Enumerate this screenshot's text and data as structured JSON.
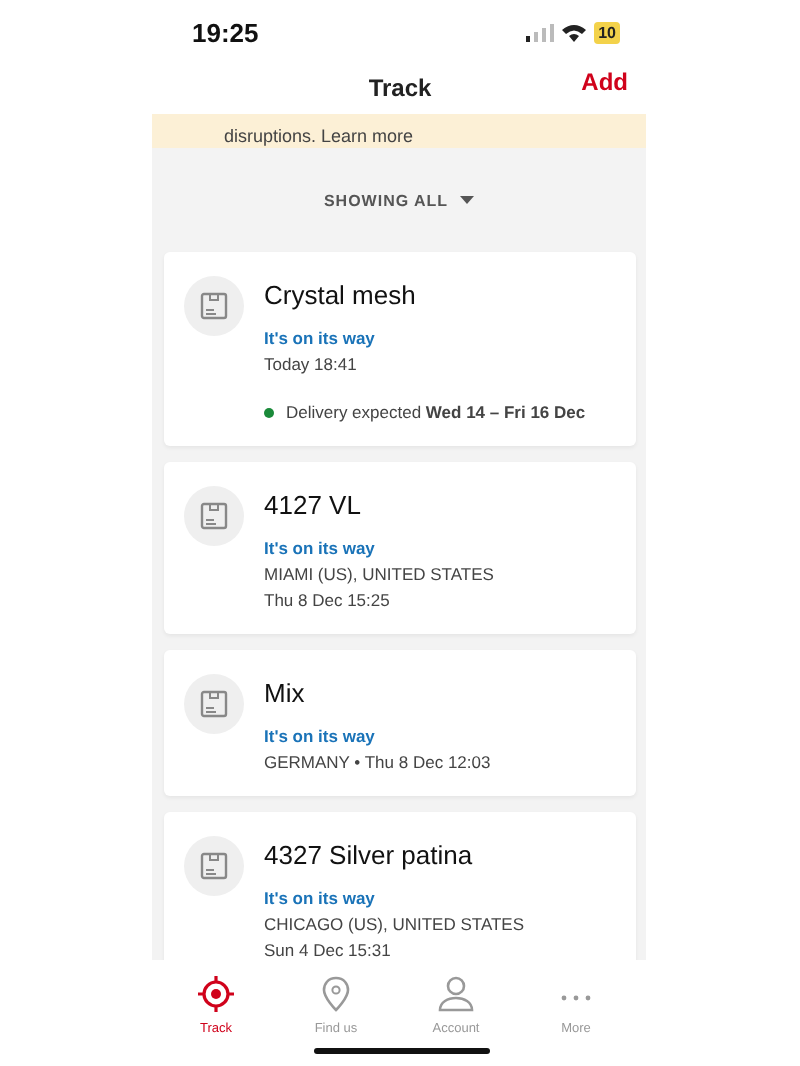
{
  "status_bar": {
    "time": "19:25",
    "battery": "10"
  },
  "header": {
    "title": "Track",
    "action": "Add"
  },
  "banner": {
    "text": "disruptions. Learn more"
  },
  "filter": {
    "label": "SHOWING ALL"
  },
  "parcels": [
    {
      "name": "Crystal mesh",
      "status": "It's on its way",
      "lines": [
        "Today 18:41"
      ],
      "delivery": {
        "text": "Delivery expected **Wed 14 – Fri 16 Dec**",
        "color": "#1a8a3a"
      }
    },
    {
      "name": "4127 VL",
      "status": "It's on its way",
      "lines": [
        "MIAMI  (US), UNITED STATES",
        "Thu 8 Dec 15:25"
      ]
    },
    {
      "name": "Mix",
      "status": "It's on its way",
      "lines": [
        "GERMANY • Thu 8 Dec 12:03"
      ]
    },
    {
      "name": "4327 Silver patina",
      "status": "It's on its way",
      "lines": [
        "CHICAGO (US), UNITED STATES",
        "Sun 4 Dec 15:31"
      ]
    }
  ],
  "tabs": [
    {
      "label": "Track",
      "kind": "target",
      "selected": true
    },
    {
      "label": "Find us",
      "kind": "pin",
      "selected": false
    },
    {
      "label": "Account",
      "kind": "person",
      "selected": false
    },
    {
      "label": "More",
      "kind": "dots",
      "selected": false
    }
  ]
}
